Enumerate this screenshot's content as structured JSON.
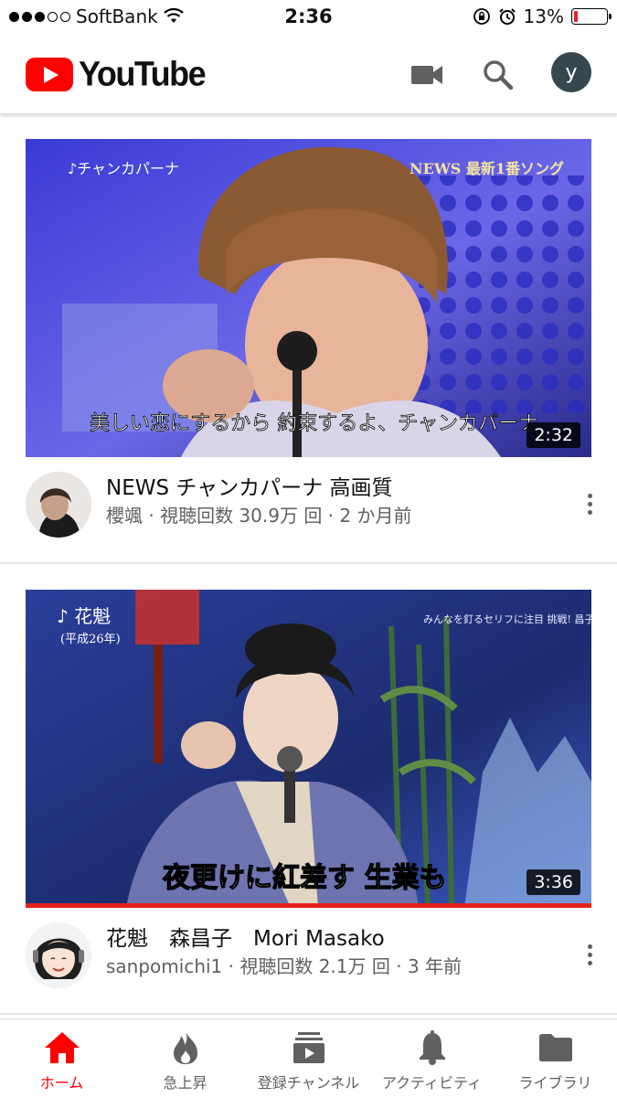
{
  "status_bar": {
    "carrier": "SoftBank",
    "time": "2:36",
    "battery_text": "13%",
    "battery_level": 0.13
  },
  "header": {
    "logo_text": "YouTube",
    "account_initial": "y"
  },
  "videos": [
    {
      "title": "NEWS チャンカパーナ 高画質",
      "meta": "櫻颯 · 視聴回数 30.9万 回 · 2 か月前",
      "duration": "2:32",
      "thumb_caption_top_left": "♪チャンカパーナ",
      "thumb_caption_top_right": "NEWS 最新1番ソング",
      "thumb_subtitle": "美しい恋にするから 約束するよ、チャンカパーナ"
    },
    {
      "title": "花魁　森昌子　Mori Masako",
      "meta": "sanpomichi1 · 視聴回数 2.1万 回 · 3 年前",
      "duration": "3:36",
      "watched_fraction": 1.0,
      "thumb_caption_top_left": "♪ 花魁",
      "thumb_caption_year": "(平成26年)",
      "thumb_caption_top_right": "みんなを釘るセリフに注目 挑戦! 昌子の新境地",
      "thumb_subtitle": "夜更けに紅差す 生業も"
    }
  ],
  "bottom_nav": [
    {
      "label": "ホーム",
      "icon": "home-icon",
      "active": true
    },
    {
      "label": "急上昇",
      "icon": "flame-icon",
      "active": false
    },
    {
      "label": "登録チャンネル",
      "icon": "subscriptions-icon",
      "active": false
    },
    {
      "label": "アクティビティ",
      "icon": "bell-icon",
      "active": false
    },
    {
      "label": "ライブラリ",
      "icon": "folder-icon",
      "active": false
    }
  ],
  "colors": {
    "brand_red": "#ff0000",
    "active_nav": "#ff0000",
    "progress": "#e62117",
    "avatar_bg": "#37474f"
  }
}
